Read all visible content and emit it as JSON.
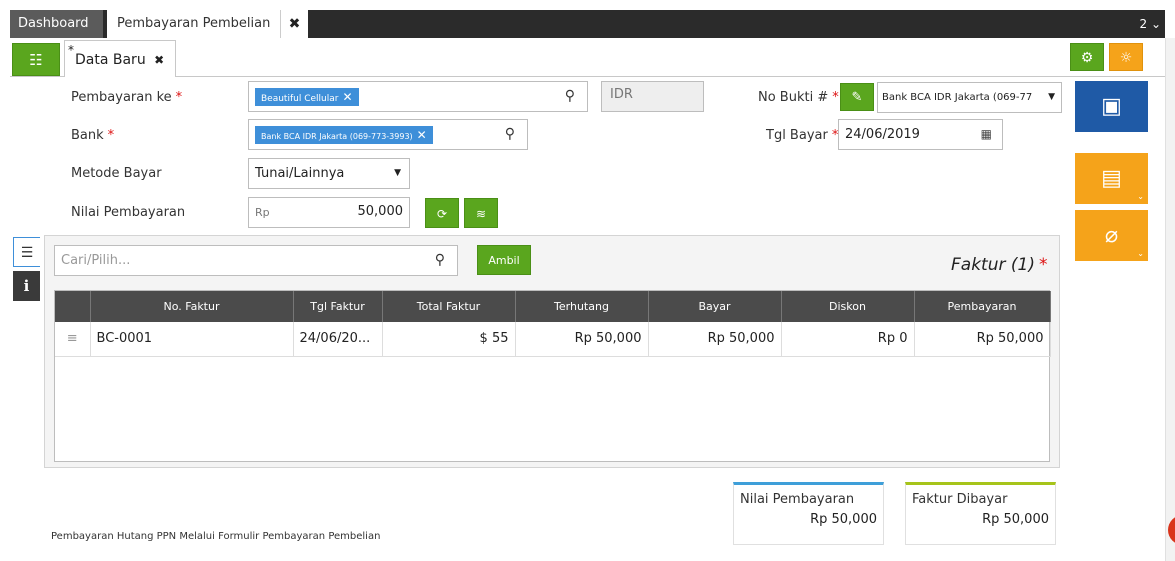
{
  "tabs": {
    "dashboard": "Dashboard",
    "active": "Pembayaran Pembelian",
    "close": "✖",
    "count": "2"
  },
  "subtab": {
    "star": "*",
    "label": "Data Baru",
    "close": "✖"
  },
  "form": {
    "pembayaran_ke_label": "Pembayaran ke",
    "pembayaran_ke_value": "Beautiful Cellular",
    "currency": "IDR",
    "bank_label": "Bank",
    "bank_value": "Bank BCA IDR Jakarta (069-773-3993)",
    "metode_label": "Metode Bayar",
    "metode_value": "Tunai/Lainnya",
    "nilai_label": "Nilai Pembayaran",
    "nilai_prefix": "Rp",
    "nilai_value": "50,000",
    "no_bukti_label": "No Bukti #",
    "no_bukti_value": "Bank BCA IDR Jakarta (069-77",
    "tgl_bayar_label": "Tgl Bayar",
    "tgl_bayar_value": "24/06/2019",
    "required_mark": "*"
  },
  "faktur": {
    "search_placeholder": "Cari/Pilih...",
    "ambil_label": "Ambil",
    "title": "Faktur (1)",
    "columns": [
      "",
      "No. Faktur",
      "Tgl Faktur",
      "Total Faktur",
      "Terhutang",
      "Bayar",
      "Diskon",
      "Pembayaran"
    ],
    "rows": [
      {
        "no_faktur": "BC-0001",
        "tgl_faktur": "24/06/20...",
        "total_faktur": "$ 55",
        "terhutang": "Rp 50,000",
        "bayar": "Rp 50,000",
        "diskon": "Rp 0",
        "pembayaran": "Rp 50,000"
      }
    ]
  },
  "summary": {
    "nilai_label": "Nilai Pembayaran",
    "nilai_value": "Rp 50,000",
    "faktur_label": "Faktur Dibayar",
    "faktur_value": "Rp 50,000"
  },
  "footer_note": "Pembayaran Hutang PPN Melalui Formulir Pembayaran Pembelian",
  "colors": {
    "green": "#5aa61e",
    "orange": "#f5a31a",
    "blue": "#1f5aa6",
    "chip_blue": "#3e8fd9"
  }
}
